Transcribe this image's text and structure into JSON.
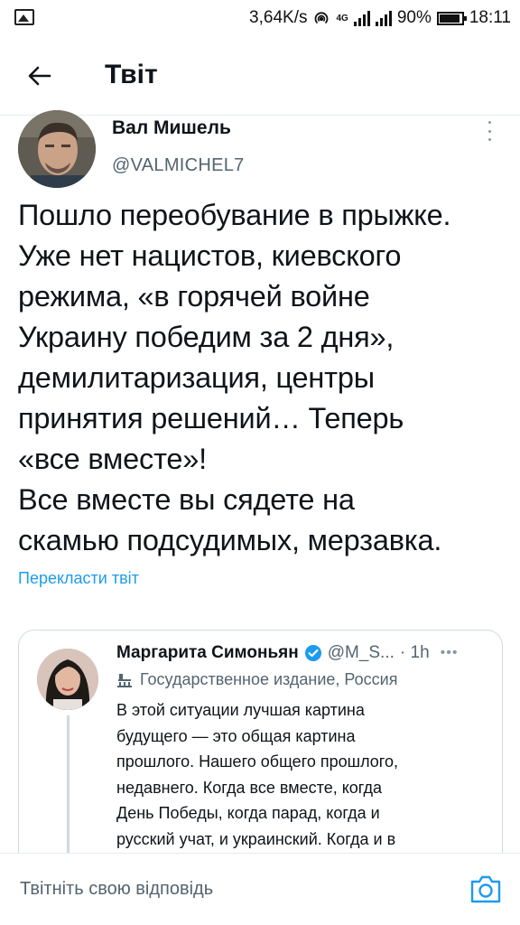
{
  "status_bar": {
    "network_speed": "3,64K/s",
    "network_type": "4G",
    "battery": "90%",
    "time": "18:11"
  },
  "header": {
    "title": "Твіт"
  },
  "tweet": {
    "author_name": "Вал Мишель",
    "author_handle": "@VALMICHEL7",
    "text_lines": [
      "Пошло переобувание в прыжке.",
      "Уже нет нацистов, киевского",
      "режима, «в горячей войне",
      "Украину победим за 2 дня»,",
      "демилитаризация, центры",
      "принятия решений… Теперь",
      "«все вместе»!",
      "Все вместе вы сядете на",
      "скамью подсудимых, мерзавка."
    ],
    "translate_label": "Перекласти твіт"
  },
  "quoted_tweet": {
    "author_name": "Маргарита Симоньян",
    "author_handle": "@M_S...",
    "time": "· 1h",
    "label": "Государственное издание, Россия",
    "text_lines": [
      "В этой ситуации лучшая картина",
      "будущего — это общая картина",
      "прошлого. Нашего общего прошлого,",
      "недавнего. Когда все вместе, когда",
      "День Победы, когда парад, когда и",
      "русский учат, и украинский. Когда и в"
    ]
  },
  "reply_bar": {
    "placeholder": "Твітніть свою відповідь"
  },
  "colors": {
    "accent": "#1d9bf0",
    "secondary_text": "#536471",
    "border": "#cfd9de"
  }
}
